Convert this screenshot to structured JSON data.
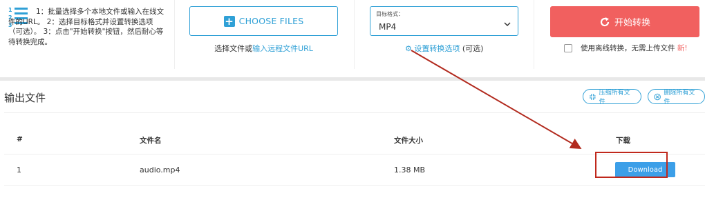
{
  "steps": {
    "text": "1：批量选择多个本地文件或输入在线文件的URL。 2：选择目标格式并设置转换选项（可选）。 3：点击\"开始转换\"按钮，然后耐心等待转换完成。"
  },
  "upload": {
    "choose_label": "CHOOSE FILES",
    "sub_prefix": "选择文件或",
    "sub_link": "输入远程文件URL"
  },
  "format": {
    "label": "目标格式：",
    "value": "MP4",
    "options_link": "设置转换选项",
    "options_suffix": "(可选)"
  },
  "convert": {
    "button_label": "开始转换",
    "offline_text": "使用离线转换，无需上传文件",
    "new_badge": "新!"
  },
  "output": {
    "title": "输出文件",
    "compress_all": "压缩所有文件",
    "delete_all": "删除所有文件",
    "columns": [
      "#",
      "文件名",
      "文件大小",
      "下载"
    ],
    "rows": [
      {
        "index": "1",
        "filename": "audio.mp4",
        "size": "1.38 MB",
        "download": "Download"
      }
    ]
  },
  "colors": {
    "accent": "#2fa0d6",
    "start": "#f1605f",
    "download": "#3c9fe8",
    "annotation": "#b22a1e"
  },
  "icons": [
    "steps-list-icon",
    "plus-icon",
    "chevron-down-icon",
    "gear-icon",
    "refresh-icon",
    "compress-icon",
    "delete-circle-icon"
  ]
}
